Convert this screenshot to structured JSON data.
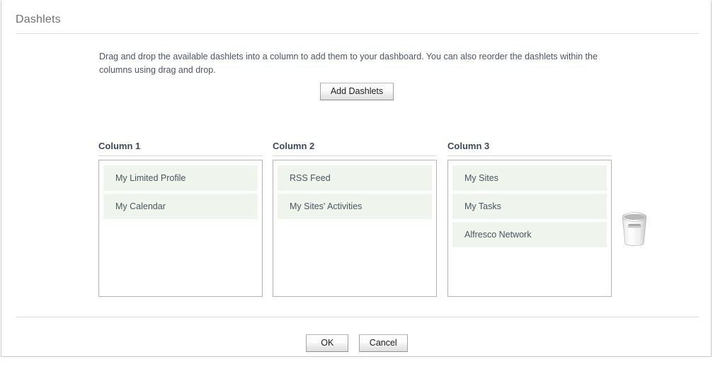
{
  "page": {
    "title": "Dashlets",
    "instructions": "Drag and drop the available dashlets into a column to add them to your dashboard. You can also reorder the dashlets within the columns using drag and drop."
  },
  "toolbar": {
    "add_dashlets_label": "Add Dashlets"
  },
  "columns": [
    {
      "title": "Column 1",
      "dashlets": [
        {
          "label": "My Limited Profile"
        },
        {
          "label": "My Calendar"
        }
      ]
    },
    {
      "title": "Column 2",
      "dashlets": [
        {
          "label": "RSS Feed"
        },
        {
          "label": "My Sites' Activities"
        }
      ]
    },
    {
      "title": "Column 3",
      "dashlets": [
        {
          "label": "My Sites"
        },
        {
          "label": "My Tasks"
        },
        {
          "label": "Alfresco Network"
        }
      ]
    }
  ],
  "trash": {
    "icon": "trash-can-icon"
  },
  "footer": {
    "ok_label": "OK",
    "cancel_label": "Cancel"
  },
  "colors": {
    "dashlet_background": "#eff4ec",
    "dashlet_text": "#4a5560",
    "title_text": "#707070",
    "column_title_text": "#3e4a57",
    "border": "#b4b4b4",
    "rule": "#dcdcdc"
  }
}
